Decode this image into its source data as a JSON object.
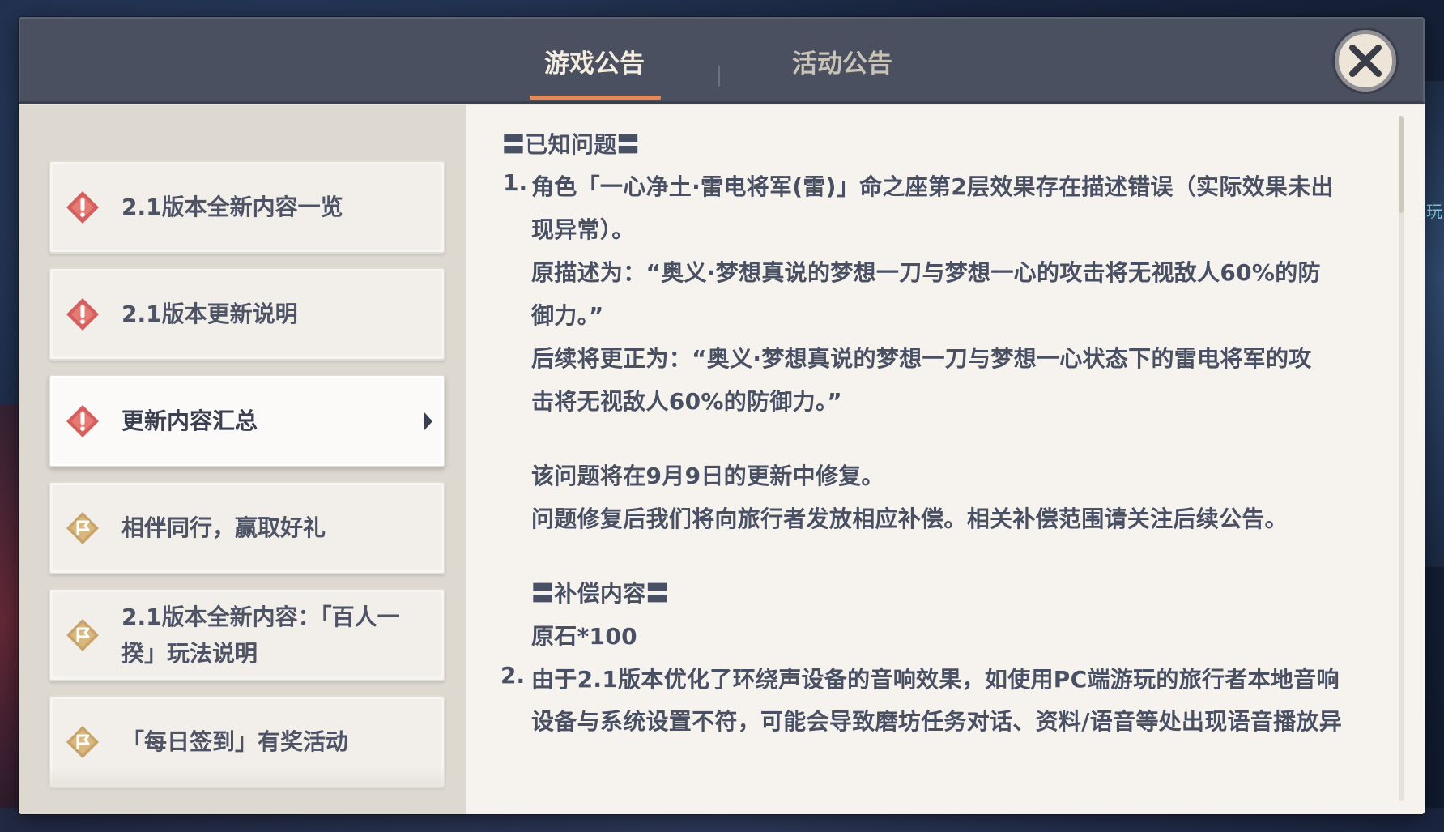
{
  "tabs": {
    "game": "游戏公告",
    "event": "活动公告"
  },
  "sidebar": {
    "items": [
      {
        "label": "2.1版本全新内容一览",
        "icon": "red-exclamation-diamond-icon"
      },
      {
        "label": "2.1版本更新说明",
        "icon": "red-exclamation-diamond-icon"
      },
      {
        "label": "更新内容汇总",
        "icon": "red-exclamation-diamond-icon",
        "selected": true
      },
      {
        "label": "相伴同行，赢取好礼",
        "icon": "gold-flag-diamond-icon"
      },
      {
        "label": "2.1版本全新内容：「百人一揆」玩法说明",
        "icon": "gold-flag-diamond-icon"
      },
      {
        "label": "「每日签到」有奖活动",
        "icon": "gold-flag-diamond-icon"
      }
    ]
  },
  "content": {
    "heading": "〓已知问题〓",
    "item1_number": "1.",
    "item1_line1": "角色「一心净土·雷电将军(雷)」命之座第2层效果存在描述错误（实际效果未出",
    "item1_line2": "现异常）。",
    "item1_line3": "原描述为：“奥义·梦想真说的梦想一刀与梦想一心的攻击将无视敌人60%的防",
    "item1_line4": "御力。”",
    "item1_line5": "后续将更正为：“奥义·梦想真说的梦想一刀与梦想一心状态下的雷电将军的攻",
    "item1_line6": "击将无视敌人60%的防御力。”",
    "item1_line7": "该问题将在9月9日的更新中修复。",
    "item1_line8": "问题修复后我们将向旅行者发放相应补偿。相关补偿范围请关注后续公告。",
    "comp_heading": "〓补偿内容〓",
    "comp_value": "原石*100",
    "item2_number": "2.",
    "item2_line1": "由于2.1版本优化了环绕声设备的音响效果，如使用PC端游玩的旅行者本地音响",
    "item2_line2": "设备与系统设置不符，可能会导致磨坊任务对话、资料/语音等处出现语音播放异"
  },
  "side_hint": "建玩"
}
